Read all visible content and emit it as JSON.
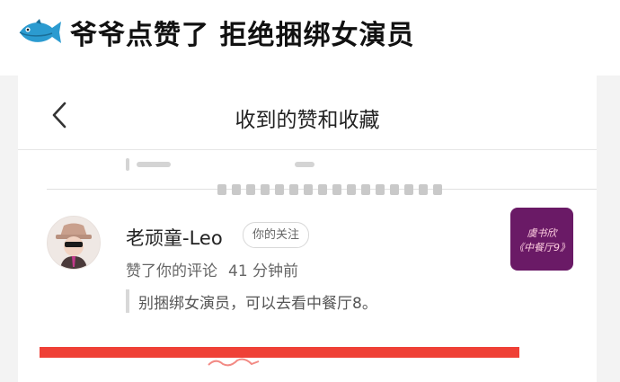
{
  "headline": {
    "icon": "fish-emoji",
    "text": "爷爷点赞了 拒绝捆绑女演员"
  },
  "nav": {
    "title": "收到的赞和收藏",
    "back_icon": "chevron-left-icon"
  },
  "notification": {
    "user_name": "老顽童-Leo",
    "follow_badge": "你的关注",
    "action": "赞了你的评论",
    "time": "41 分钟前",
    "comment": "别捆绑女演员，可以去看中餐厅8。",
    "thumbnail": {
      "line1": "虞书欣",
      "line2": "《中餐厅9》"
    }
  },
  "colors": {
    "accent_red": "#ef4036",
    "thumbnail_bg": "#6a1a66"
  }
}
